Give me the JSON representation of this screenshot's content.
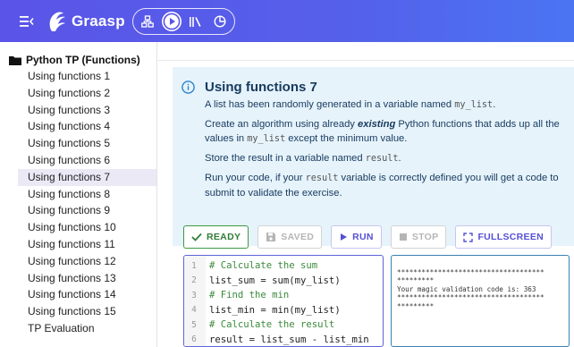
{
  "header": {
    "app_name": "Graasp",
    "colors": {
      "start": "#5a54e8",
      "end": "#4a74f2"
    }
  },
  "sidebar": {
    "root_label": "Python TP (Functions)",
    "items": [
      {
        "label": "Using functions 1"
      },
      {
        "label": "Using functions 2"
      },
      {
        "label": "Using functions 3"
      },
      {
        "label": "Using functions 4"
      },
      {
        "label": "Using functions 5"
      },
      {
        "label": "Using functions 6"
      },
      {
        "label": "Using functions 7",
        "active": true
      },
      {
        "label": "Using functions 8"
      },
      {
        "label": "Using functions 9"
      },
      {
        "label": "Using functions 10"
      },
      {
        "label": "Using functions 11"
      },
      {
        "label": "Using functions 12"
      },
      {
        "label": "Using functions 13"
      },
      {
        "label": "Using functions 14"
      },
      {
        "label": "Using functions 15"
      },
      {
        "label": "TP Evaluation"
      }
    ]
  },
  "info": {
    "title": "Using functions 7",
    "p1_text": "A list has been randomly generated in a variable named ",
    "p1_code": "my_list",
    "p1_end": ".",
    "p2_start": "Create an algorithm using already ",
    "p2_em": "existing",
    "p2_mid": " Python functions that adds up all the values in ",
    "p2_code": "my_list",
    "p2_end": " except the minimum value.",
    "p3_text": "Store the result in a variable named ",
    "p3_code": "result",
    "p3_end": ".",
    "p4_start": "Run your code, if your ",
    "p4_code": "result",
    "p4_end": " variable is correctly defined you will get a code to submit to validate the exercise."
  },
  "toolbar": {
    "ready": "READY",
    "saved": "SAVED",
    "run": "RUN",
    "stop": "STOP",
    "fullscreen": "FULLSCREEN"
  },
  "editor": {
    "lines": [
      {
        "n": "1",
        "text": "# Calculate the sum"
      },
      {
        "n": "2",
        "text": "list_sum = sum(my_list)"
      },
      {
        "n": "3",
        "text": "# Find the min"
      },
      {
        "n": "4",
        "text": "list_min = min(my_list)"
      },
      {
        "n": "5",
        "text": "# Calculate the result"
      },
      {
        "n": "6",
        "text": "result = list_sum - list_min"
      }
    ]
  },
  "output": {
    "lines": [
      "************************************",
      "*********",
      "Your magic validation code is: 363",
      "************************************",
      "*********"
    ]
  }
}
